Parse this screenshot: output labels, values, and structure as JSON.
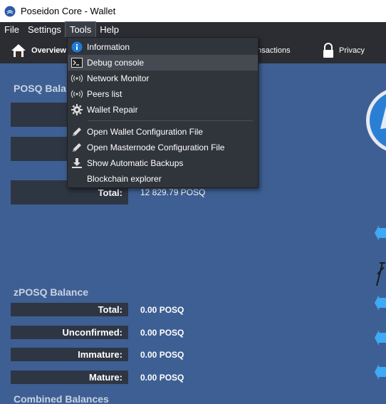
{
  "window": {
    "title": "Poseidon Core - Wallet"
  },
  "menubar": {
    "items": [
      "File",
      "Settings",
      "Tools",
      "Help"
    ]
  },
  "toolbar": {
    "overview": "Overview",
    "transactions": "ansactions",
    "privacy": "Privacy"
  },
  "posq": {
    "title": "POSQ Bala",
    "total_label": "Total:",
    "total_value": "12 829.79 POSQ"
  },
  "zposq": {
    "title": "zPOSQ Balance",
    "rows": [
      {
        "label": "Total:",
        "value": "0.00 POSQ"
      },
      {
        "label": "Unconfirmed:",
        "value": "0.00 POSQ"
      },
      {
        "label": "Immature:",
        "value": "0.00 POSQ"
      },
      {
        "label": "Mature:",
        "value": "0.00 POSQ"
      }
    ]
  },
  "combined": {
    "title": "Combined Balances"
  },
  "tools_menu": {
    "items": [
      "Information",
      "Debug console",
      "Network Monitor",
      "Peers list",
      "Wallet Repair",
      "Open Wallet Configuration File",
      "Open Masternode Configuration File",
      "Show Automatic Backups",
      "Blockchain explorer"
    ]
  },
  "colors": {
    "background": "#3e5f93",
    "menubar": "#2b2d32",
    "label_box": "#2e3644",
    "accent": "#3fa9f5"
  }
}
